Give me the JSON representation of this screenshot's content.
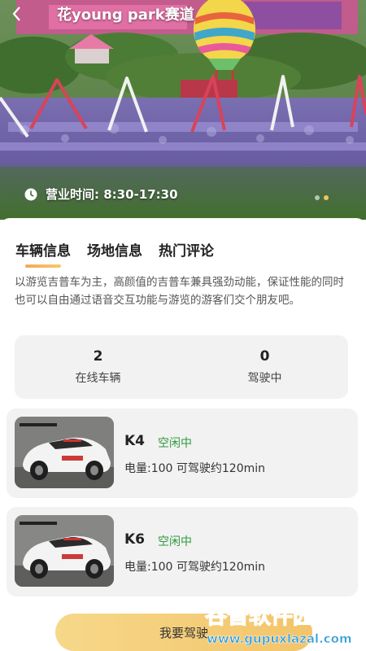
{
  "header": {
    "title": "花young park赛道",
    "back_icon": "chevron-left-icon"
  },
  "hero": {
    "hours_label": "营业时间: 8:30-17:30",
    "clock_icon": "clock-icon",
    "carousel_total": 2,
    "carousel_active": 2
  },
  "tabs": [
    {
      "label": "车辆信息",
      "active": true
    },
    {
      "label": "场地信息",
      "active": false
    },
    {
      "label": "热门评论",
      "active": false
    }
  ],
  "description": "以游览吉普车为主，高颜值的吉普车兼具强劲动能，保证性能的同时也可以自由通过语音交互功能与游览的游客们交个朋友吧。",
  "stats": [
    {
      "value": "2",
      "label": "在线车辆"
    },
    {
      "value": "0",
      "label": "驾驶中"
    }
  ],
  "cars": [
    {
      "name": "K4",
      "status": "空闲中",
      "info": "电量:100  可驾驶约120min"
    },
    {
      "name": "K6",
      "status": "空闲中",
      "info": "电量:100  可驾驶约120min"
    }
  ],
  "action": {
    "drive_label": "我要驾驶"
  },
  "watermark": {
    "text_cn": "谷普软件园",
    "text_url": "www.gupuxlazal.com"
  },
  "colors": {
    "accent": "#f3c46a",
    "status_green": "#2e9a3d",
    "card_bg": "#f2f2f2"
  }
}
